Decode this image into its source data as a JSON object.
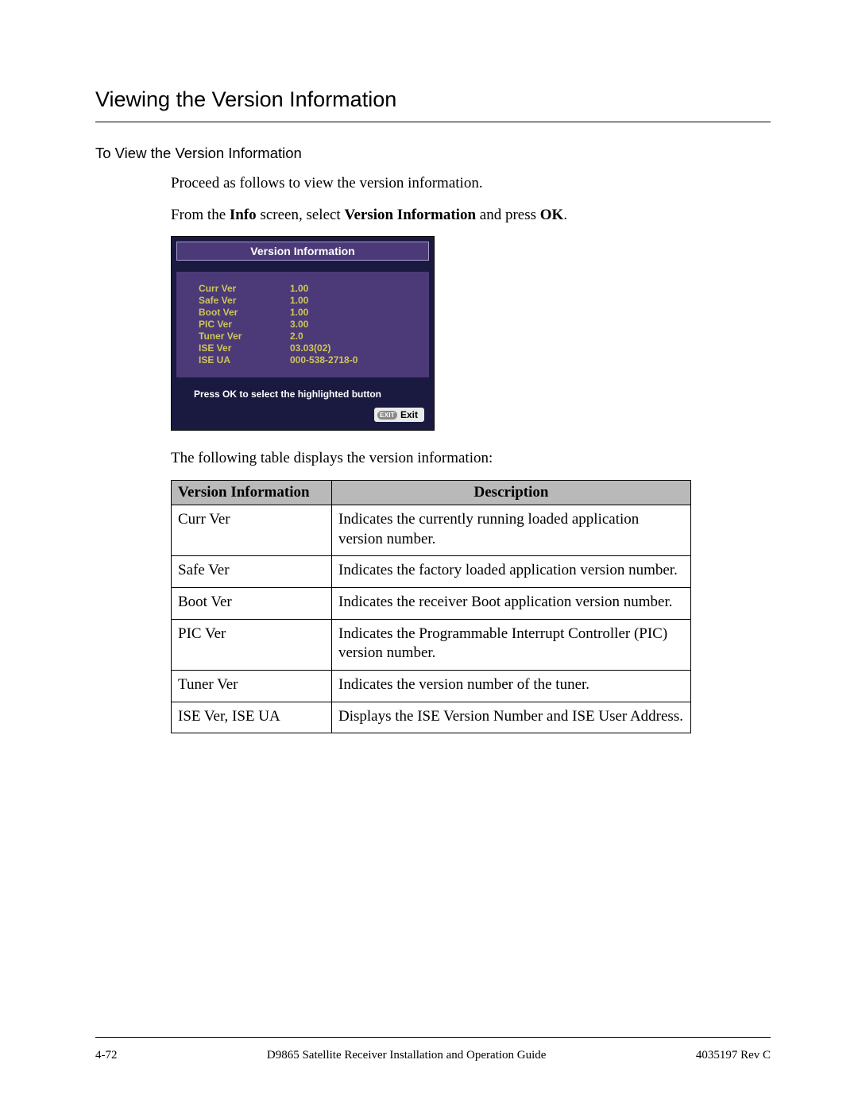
{
  "heading": "Viewing the Version Information",
  "subheading": "To View the Version Information",
  "para1": "Proceed as follows to view the version information.",
  "para2_pre": "From the ",
  "para2_b1": "Info",
  "para2_mid1": " screen, select ",
  "para2_b2": "Version Information",
  "para2_mid2": " and press ",
  "para2_b3": "OK",
  "para2_post": ".",
  "osd": {
    "title": "Version Information",
    "rows": [
      {
        "label": "Curr Ver",
        "value": "1.00"
      },
      {
        "label": "Safe Ver",
        "value": "1.00"
      },
      {
        "label": "Boot Ver",
        "value": "1.00"
      },
      {
        "label": "PIC Ver",
        "value": "3.00"
      },
      {
        "label": "Tuner Ver",
        "value": "2.0"
      },
      {
        "label": "ISE Ver",
        "value": "03.03(02)"
      },
      {
        "label": "ISE UA",
        "value": "000-538-2718-0"
      }
    ],
    "hint": "Press OK to select the highlighted button",
    "exit_badge": "EXIT",
    "exit_label": "Exit"
  },
  "table_intro": "The following table displays the version information:",
  "table": {
    "head_col1": "Version Information",
    "head_col2": "Description",
    "rows": [
      {
        "k": "Curr Ver",
        "d": "Indicates the currently running loaded application version number."
      },
      {
        "k": "Safe Ver",
        "d": "Indicates the factory loaded application version number."
      },
      {
        "k": "Boot Ver",
        "d": "Indicates the receiver Boot application version number."
      },
      {
        "k": "PIC Ver",
        "d": "Indicates the Programmable Interrupt Controller (PIC) version number."
      },
      {
        "k": "Tuner Ver",
        "d": "Indicates the version number of the tuner."
      },
      {
        "k": "ISE Ver, ISE UA",
        "d": "Displays the ISE Version Number and ISE User Address."
      }
    ]
  },
  "footer": {
    "left": "4-72",
    "center": "D9865 Satellite Receiver Installation and Operation Guide",
    "right": "4035197 Rev C"
  }
}
